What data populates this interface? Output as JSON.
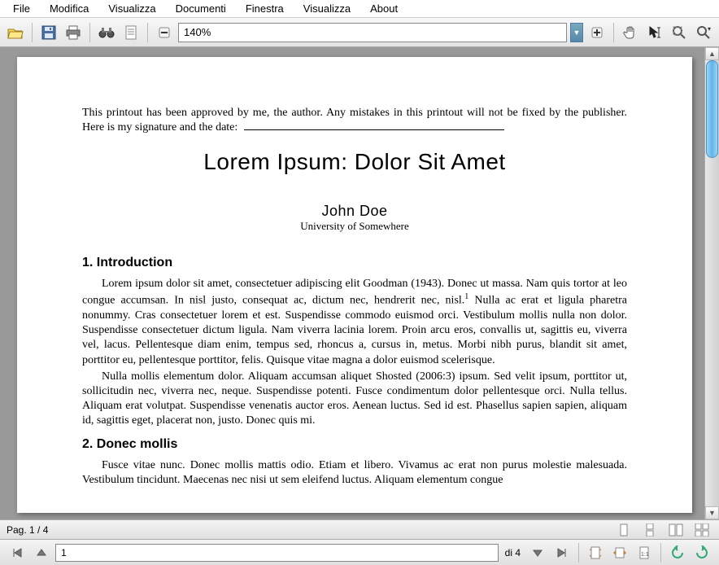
{
  "menu": {
    "file": "File",
    "modifica": "Modifica",
    "visualizza": "Visualizza",
    "documenti": "Documenti",
    "finestra": "Finestra",
    "visualizza2": "Visualizza",
    "about": "About"
  },
  "toolbar": {
    "zoom_value": "140%"
  },
  "document": {
    "approval_text": "This printout has been approved by me, the author. Any mistakes in this printout will not be fixed by the publisher. Here is my signature and the date:",
    "title": "Lorem Ipsum: Dolor Sit Amet",
    "author": "John Doe",
    "affiliation": "University of Somewhere",
    "section1_heading": "1. Introduction",
    "section1_para1": "Lorem ipsum dolor sit amet, consectetuer adipiscing elit Goodman (1943). Donec ut massa. Nam quis tortor at leo congue accumsan. In nisl justo, consequat ac, dictum nec, hendrerit nec, nisl.",
    "section1_footref": "1",
    "section1_para1b": " Nulla ac erat et ligula pharetra nonummy. Cras consectetuer lorem et est. Suspendisse commodo euismod orci. Vestibulum mollis nulla non dolor. Suspendisse consectetuer dictum ligula. Nam viverra lacinia lorem. Proin arcu eros, convallis ut, sagittis eu, viverra vel, lacus. Pellentesque diam enim, tempus sed, rhoncus a, cursus in, metus. Morbi nibh purus, blandit sit amet, porttitor eu, pellentesque porttitor, felis. Quisque vitae magna a dolor euismod scelerisque.",
    "section1_para2": "Nulla mollis elementum dolor.  Aliquam accumsan aliquet Shosted (2006:3) ipsum.  Sed velit ipsum, porttitor ut, sollicitudin nec, viverra nec, neque. Suspendisse potenti. Fusce condimentum dolor pellentesque orci. Nulla tellus. Aliquam erat volutpat. Suspendisse venenatis auctor eros. Aenean luctus. Sed id est. Phasellus sapien sapien, aliquam id, sagittis eget, placerat non, justo. Donec quis mi.",
    "section2_heading": "2. Donec mollis",
    "section2_para1": "Fusce vitae nunc. Donec mollis mattis odio. Etiam et libero. Vivamus ac erat non purus molestie malesuada. Vestibulum tincidunt. Maecenas nec nisi ut sem eleifend luctus. Aliquam elementum congue"
  },
  "status": {
    "page_indicator": "Pag. 1 / 4"
  },
  "footer": {
    "current_page": "1",
    "total_label": "di 4"
  }
}
